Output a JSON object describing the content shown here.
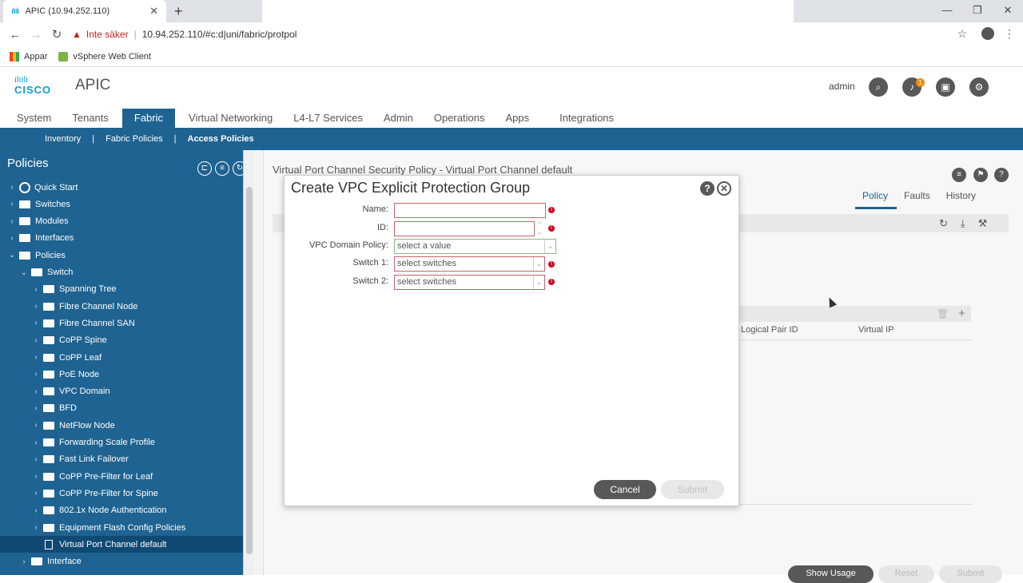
{
  "browser": {
    "tab_title": "APIC (10.94.252.110)",
    "tab_close": "✕",
    "new_tab": "+",
    "security_label": "Inte säker",
    "url": "10.94.252.110/#c:d|uni/fabric/protpol",
    "bookmarks": [
      {
        "label": "Appar",
        "icon": "apps-grid-icon"
      },
      {
        "label": "vSphere Web Client",
        "icon": "vsphere-icon"
      }
    ]
  },
  "header": {
    "logo_text": "CISCO",
    "app_name": "APIC",
    "user": "admin",
    "notification_count": "1"
  },
  "topnav": {
    "items": [
      "System",
      "Tenants",
      "Fabric",
      "Virtual Networking",
      "L4-L7 Services",
      "Admin",
      "Operations",
      "Apps",
      "Integrations"
    ],
    "active": "Fabric"
  },
  "subnav": {
    "items": [
      "Inventory",
      "Fabric Policies",
      "Access Policies"
    ],
    "separator": "|",
    "active": "Access Policies"
  },
  "sidebar": {
    "title": "Policies",
    "tree": [
      {
        "label": "Quick Start",
        "level": 0,
        "type": "quickstart"
      },
      {
        "label": "Switches",
        "level": 0,
        "type": "folder"
      },
      {
        "label": "Modules",
        "level": 0,
        "type": "folder"
      },
      {
        "label": "Interfaces",
        "level": 0,
        "type": "folder"
      },
      {
        "label": "Policies",
        "level": 0,
        "type": "folder",
        "expanded": true
      },
      {
        "label": "Switch",
        "level": 1,
        "type": "folder",
        "expanded": true
      },
      {
        "label": "Spanning Tree",
        "level": 2,
        "type": "folder"
      },
      {
        "label": "Fibre Channel Node",
        "level": 2,
        "type": "folder"
      },
      {
        "label": "Fibre Channel SAN",
        "level": 2,
        "type": "folder"
      },
      {
        "label": "CoPP Spine",
        "level": 2,
        "type": "folder"
      },
      {
        "label": "CoPP Leaf",
        "level": 2,
        "type": "folder"
      },
      {
        "label": "PoE Node",
        "level": 2,
        "type": "folder"
      },
      {
        "label": "VPC Domain",
        "level": 2,
        "type": "folder"
      },
      {
        "label": "BFD",
        "level": 2,
        "type": "folder"
      },
      {
        "label": "NetFlow Node",
        "level": 2,
        "type": "folder"
      },
      {
        "label": "Forwarding Scale Profile",
        "level": 2,
        "type": "folder"
      },
      {
        "label": "Fast Link Failover",
        "level": 2,
        "type": "folder"
      },
      {
        "label": "CoPP Pre-Filter for Leaf",
        "level": 2,
        "type": "folder"
      },
      {
        "label": "CoPP Pre-Filter for Spine",
        "level": 2,
        "type": "folder"
      },
      {
        "label": "802.1x Node Authentication",
        "level": 2,
        "type": "folder"
      },
      {
        "label": "Equipment Flash Config Policies",
        "level": 2,
        "type": "folder"
      },
      {
        "label": "Virtual Port Channel default",
        "level": 2,
        "type": "doc",
        "selected": true
      },
      {
        "label": "Interface",
        "level": 1,
        "type": "folder"
      }
    ]
  },
  "main": {
    "title": "Virtual Port Channel Security Policy - Virtual Port Channel default",
    "tabs": [
      "Policy",
      "Faults",
      "History"
    ],
    "active_tab": "Policy",
    "columns": [
      "Logical Pair ID",
      "Virtual IP"
    ],
    "bottom_buttons": [
      "Show Usage",
      "Reset",
      "Submit"
    ]
  },
  "dialog": {
    "title": "Create VPC Explicit Protection Group",
    "fields": {
      "name_label": "Name:",
      "name_value": "",
      "id_label": "ID:",
      "id_value": "",
      "domain_label": "VPC Domain Policy:",
      "domain_placeholder": "select a value",
      "switch1_label": "Switch 1:",
      "switch1_placeholder": "select switches",
      "switch2_label": "Switch 2:",
      "switch2_placeholder": "select switches"
    },
    "cancel_label": "Cancel",
    "submit_label": "Submit"
  },
  "colors": {
    "cisco_blue": "#049fd9",
    "nav_blue": "#1e6391",
    "required_red": "#d0021b"
  }
}
